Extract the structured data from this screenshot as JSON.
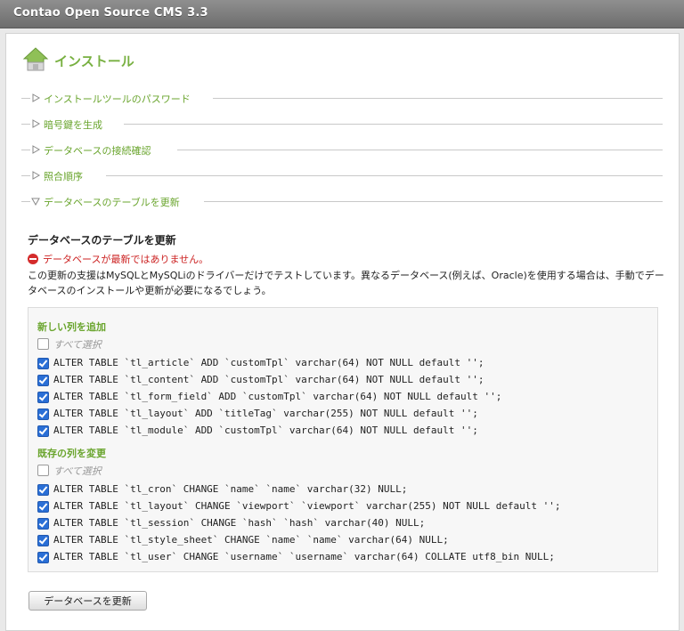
{
  "app": {
    "title": "Contao Open Source CMS 3.3"
  },
  "heading": {
    "label": "インストール",
    "icon": "house-icon"
  },
  "sections": [
    {
      "label": "インストールツールのパスワード",
      "expanded": false
    },
    {
      "label": "暗号鍵を生成",
      "expanded": false
    },
    {
      "label": "データベースの接続確認",
      "expanded": false
    },
    {
      "label": "照合順序",
      "expanded": false
    },
    {
      "label": "データベースのテーブルを更新",
      "expanded": true
    }
  ],
  "update": {
    "title": "データベースのテーブルを更新",
    "error": "データベースが最新ではありません。",
    "description": "この更新の支援はMySQLとMySQLiのドライバーだけでテストしています。異なるデータベース(例えば、Oracle)を使用する場合は、手動でデータベースのインストールや更新が必要になるでしょう。"
  },
  "groups": {
    "add": {
      "title": "新しい列を追加",
      "select_all": "すべて選択",
      "select_all_checked": false,
      "items": [
        {
          "sql": "ALTER TABLE `tl_article` ADD `customTpl` varchar(64) NOT NULL default '';",
          "checked": true
        },
        {
          "sql": "ALTER TABLE `tl_content` ADD `customTpl` varchar(64) NOT NULL default '';",
          "checked": true
        },
        {
          "sql": "ALTER TABLE `tl_form_field` ADD `customTpl` varchar(64) NOT NULL default '';",
          "checked": true
        },
        {
          "sql": "ALTER TABLE `tl_layout` ADD `titleTag` varchar(255) NOT NULL default '';",
          "checked": true
        },
        {
          "sql": "ALTER TABLE `tl_module` ADD `customTpl` varchar(64) NOT NULL default '';",
          "checked": true
        }
      ]
    },
    "change": {
      "title": "既存の列を変更",
      "select_all": "すべて選択",
      "select_all_checked": false,
      "items": [
        {
          "sql": "ALTER TABLE `tl_cron` CHANGE `name` `name` varchar(32) NULL;",
          "checked": true
        },
        {
          "sql": "ALTER TABLE `tl_layout` CHANGE `viewport` `viewport` varchar(255) NOT NULL default '';",
          "checked": true
        },
        {
          "sql": "ALTER TABLE `tl_session` CHANGE `hash` `hash` varchar(40) NULL;",
          "checked": true
        },
        {
          "sql": "ALTER TABLE `tl_style_sheet` CHANGE `name` `name` varchar(64) NULL;",
          "checked": true
        },
        {
          "sql": "ALTER TABLE `tl_user` CHANGE `username` `username` varchar(64) COLLATE utf8_bin NULL;",
          "checked": true
        }
      ]
    }
  },
  "button": {
    "label": "データベースを更新"
  },
  "colors": {
    "accent": "#78b041",
    "error": "#cc2222",
    "titlebar": "#7a7a7a"
  }
}
